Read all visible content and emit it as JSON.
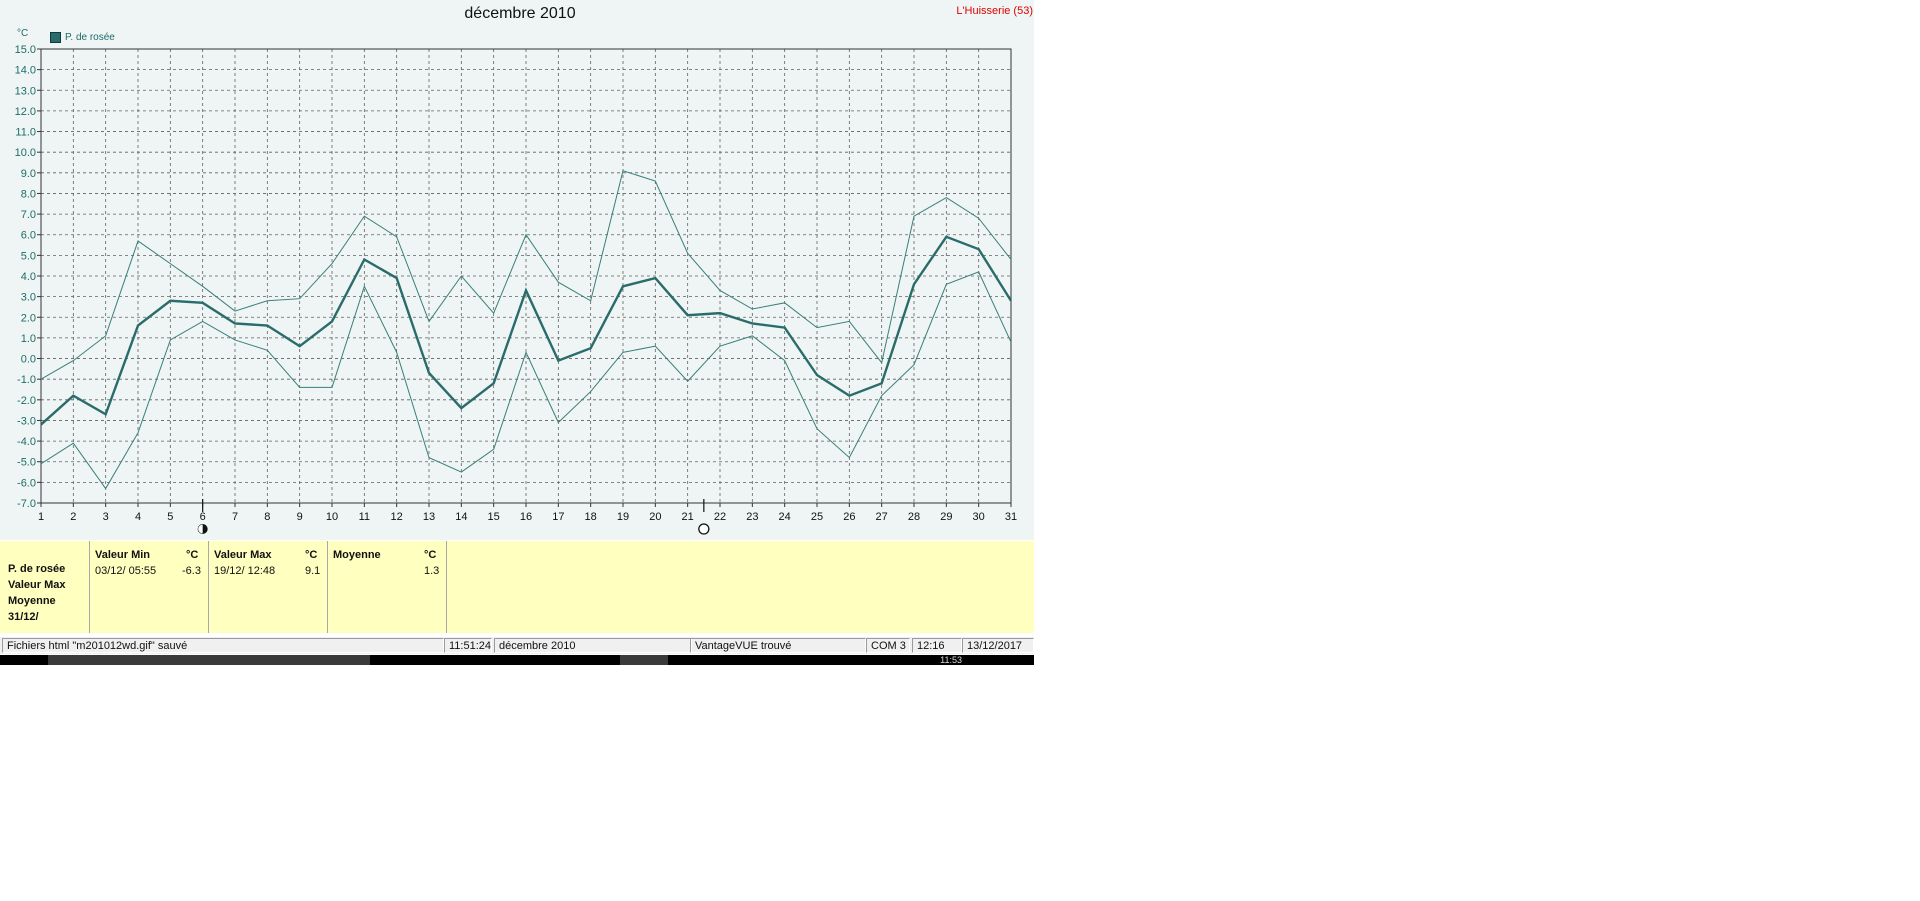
{
  "title": "décembre 2010",
  "station": "L'Huisserie (53)",
  "unit": "°C",
  "legend": {
    "label": "P. de rosée"
  },
  "colors": {
    "background": "#eef5f4",
    "series_main": "#2a6b6b",
    "series_range": "#3a7f7a",
    "grid": "#606060",
    "axis_text": "#1e6b6b",
    "stats_bg": "#ffffc0",
    "station_red": "#e00000"
  },
  "moon_icons": [
    {
      "name": "last-quarter-moon-icon",
      "day": 6
    },
    {
      "name": "full-moon-icon",
      "day": 21.5
    }
  ],
  "chart_data": {
    "type": "line",
    "title": "décembre 2010",
    "ylabel": "°C",
    "xlim": [
      1,
      31
    ],
    "ylim": [
      -7,
      15
    ],
    "yticks": [
      "-7.0",
      "-6.0",
      "-5.0",
      "-4.0",
      "-3.0",
      "-2.0",
      "-1.0",
      "0.0",
      "1.0",
      "2.0",
      "3.0",
      "4.0",
      "5.0",
      "6.0",
      "7.0",
      "8.0",
      "9.0",
      "10.0",
      "11.0",
      "12.0",
      "13.0",
      "14.0",
      "15.0"
    ],
    "xticks": [
      "1",
      "2",
      "3",
      "4",
      "5",
      "6",
      "7",
      "8",
      "9",
      "10",
      "11",
      "12",
      "13",
      "14",
      "15",
      "16",
      "17",
      "18",
      "19",
      "20",
      "21",
      "22",
      "23",
      "24",
      "25",
      "26",
      "27",
      "28",
      "29",
      "30",
      "31"
    ],
    "grid": true,
    "legend_position": "top-left",
    "x": [
      1,
      2,
      3,
      4,
      5,
      6,
      7,
      8,
      9,
      10,
      11,
      12,
      13,
      14,
      15,
      16,
      17,
      18,
      19,
      20,
      21,
      22,
      23,
      24,
      25,
      26,
      27,
      28,
      29,
      30,
      31
    ],
    "series": [
      {
        "name": "P. de rosée",
        "values": [
          -3.2,
          -1.8,
          -2.7,
          1.6,
          2.8,
          2.7,
          1.7,
          1.6,
          0.6,
          1.8,
          4.8,
          3.9,
          -0.7,
          -2.4,
          -1.2,
          3.3,
          -0.1,
          0.5,
          3.5,
          3.9,
          2.1,
          2.2,
          1.7,
          1.5,
          -0.8,
          -1.8,
          -1.2,
          3.6,
          5.9,
          5.3,
          2.8
        ]
      },
      {
        "values": [
          -1.0,
          -0.1,
          1.1,
          5.7,
          4.6,
          3.5,
          2.3,
          2.8,
          2.9,
          4.6,
          6.9,
          5.9,
          1.8,
          4.0,
          2.2,
          6.0,
          3.7,
          2.8,
          9.1,
          8.6,
          5.1,
          3.3,
          2.4,
          2.7,
          1.5,
          1.8,
          -0.2,
          6.9,
          7.8,
          6.8,
          4.8
        ]
      },
      {
        "values": [
          -5.1,
          -4.1,
          -6.3,
          -3.6,
          0.9,
          1.8,
          0.9,
          0.4,
          -1.4,
          -1.4,
          3.5,
          0.3,
          -4.8,
          -5.5,
          -4.4,
          0.3,
          -3.1,
          -1.6,
          0.3,
          0.6,
          -1.1,
          0.6,
          1.1,
          -0.1,
          -3.4,
          -4.8,
          -1.8,
          -0.3,
          3.6,
          4.2,
          0.8
        ]
      }
    ]
  },
  "stats": {
    "row_labels": [
      "P. de rosée",
      "Valeur Max",
      "Moyenne",
      "31/12/"
    ],
    "min": {
      "header": "Valeur Min",
      "unit": "°C",
      "date": "03/12/  05:55",
      "value": "-6.3"
    },
    "max": {
      "header": "Valeur Max",
      "unit": "°C",
      "date": "19/12/  12:48",
      "value": "9.1"
    },
    "avg": {
      "header": "Moyenne",
      "unit": "°C",
      "value": "1.3"
    }
  },
  "status": {
    "file": "Fichiers html  \"m201012wd.gif\"  sauvé",
    "time": "11:51:24",
    "period": "décembre 2010",
    "device": "VantageVUE trouvé",
    "port": "COM 3",
    "clock": "12:16",
    "date": "13/12/2017"
  },
  "taskbar": {
    "clock": "11:53"
  }
}
